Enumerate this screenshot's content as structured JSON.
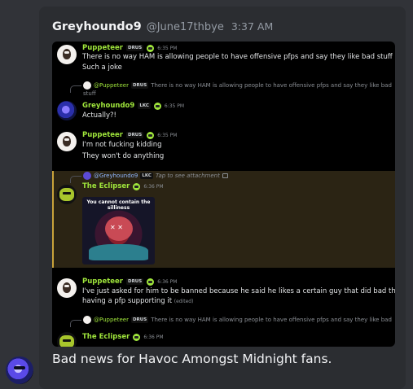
{
  "message": {
    "author": "Greyhoundo9",
    "handle": "@June17thbye",
    "time": "3:37 AM",
    "caption": "Bad news for Havoc Amongst Midnight fans."
  },
  "embedded": {
    "msg1": {
      "user": "Puppeteer",
      "tag": "DRUS",
      "time": "6:35 PM",
      "lines": [
        "There is no way HAM is allowing people to have offensive pfps and say they like bad stuff",
        "Such a joke"
      ]
    },
    "reply1": {
      "user": "@Puppeteer",
      "tag": "DRUS",
      "text": "There is no way HAM is allowing people to have offensive pfps and say they like bad",
      "cont": "stuff"
    },
    "msg2": {
      "user": "Greyhoundo9",
      "tag": "LKC",
      "time": "6:35 PM",
      "line": "Actually?!"
    },
    "msg3": {
      "user": "Puppeteer",
      "tag": "DRUS",
      "time": "6:35 PM",
      "lines": [
        "I'm not fucking kidding",
        "They won't do anything"
      ]
    },
    "reply2": {
      "user": "@Greyhoundo9",
      "tag": "LKC",
      "text": "Tap to see attachment"
    },
    "msg4": {
      "user": "The Eclipser",
      "time": "6:36 PM",
      "image_caption": "You cannot contain the silliness"
    },
    "msg5": {
      "user": "Puppeteer",
      "tag": "DRUS",
      "time": "6:36 PM",
      "line1": "I've just asked for him to be banned because he said he likes a certain guy that did bad things while",
      "line2": "having a pfp supporting it",
      "edited": "(edited)"
    },
    "reply3": {
      "user": "@Puppeteer",
      "tag": "DRUS",
      "text": "There is no way HAM is allowing people to have offensive pfps and say they like bad"
    },
    "msg6": {
      "user": "The Eclipser",
      "time": "6:36 PM"
    }
  }
}
